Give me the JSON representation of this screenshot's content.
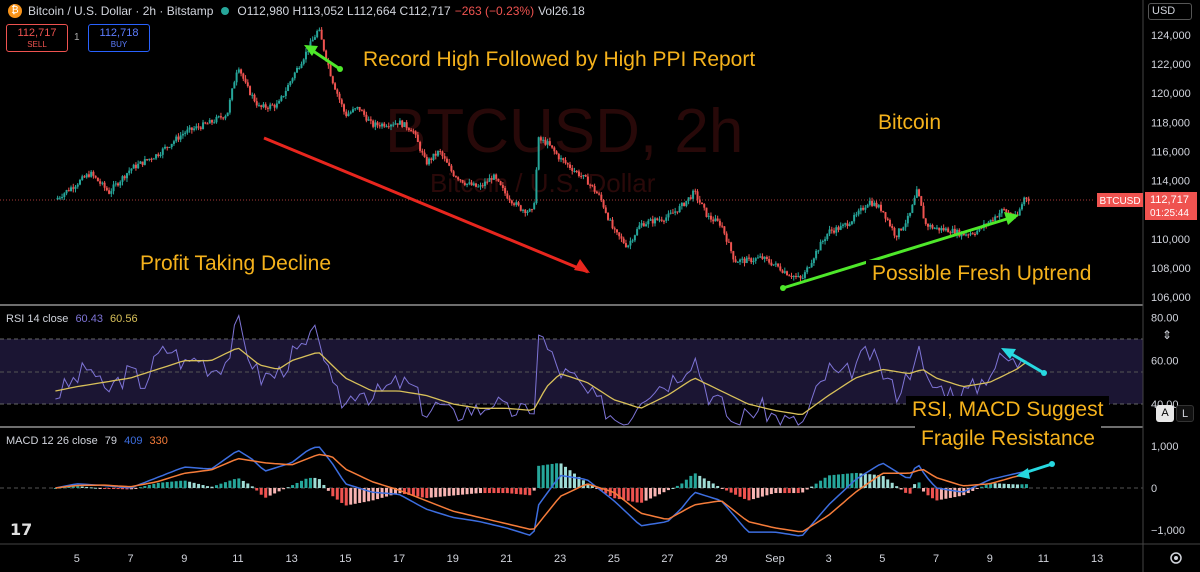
{
  "header": {
    "logo_glyph": "₿",
    "title": "Bitcoin / U.S. Dollar · 2h · Bitstamp",
    "ohlc": "O112,980 H113,052 L112,664 C112,717",
    "change": "−263 (−0.23%)",
    "volume": "Vol26.18"
  },
  "trade": {
    "sell_price": "112,717",
    "sell_label": "SELL",
    "spread": "1",
    "buy_price": "112,718",
    "buy_label": "BUY"
  },
  "currency_button": "USD",
  "scale_buttons": {
    "auto": "A",
    "log": "L"
  },
  "watermark": {
    "symbol": "BTCUSD, 2h",
    "subtitle": "Bitcoin / U.S. Dollar"
  },
  "annotations": {
    "record_high": "Record High Followed by High PPI Report",
    "bitcoin": "Bitcoin",
    "profit_taking": "Profit Taking Decline",
    "uptrend": "Possible Fresh Uptrend",
    "rsi_macd_line1": "RSI, MACD Suggest",
    "rsi_macd_line2": "Fragile Resistance"
  },
  "price_badge": {
    "symbol": "BTCUSD",
    "price": "112,717",
    "countdown": "01:25:44"
  },
  "rsi_label": {
    "text": "RSI 14 close",
    "rsi": "60.43",
    "ma": "60.56"
  },
  "macd_label": {
    "text": "MACD 12 26 close",
    "hist": "79",
    "macd": "409",
    "signal": "330"
  },
  "logo_text": "17",
  "colors": {
    "up": "#26a69a",
    "down": "#ef5350",
    "rsi": "#7e74d6",
    "rsi_ma": "#d8c05a",
    "macd": "#3d6ee0",
    "signal": "#f57c3a",
    "annotation": "#f5b21c",
    "arrow_red": "#e8261e",
    "arrow_green": "#4ee82a",
    "arrow_cyan": "#27d8e0"
  },
  "chart_data": [
    {
      "type": "candlestick",
      "ylim": [
        105500,
        125000
      ],
      "y_ticks": [
        "106,000",
        "108,000",
        "110,000",
        "112,000",
        "114,000",
        "116,000",
        "118,000",
        "120,000",
        "122,000",
        "124,000"
      ],
      "x_ticks": [
        "5",
        "7",
        "9",
        "11",
        "13",
        "15",
        "17",
        "19",
        "21",
        "23",
        "25",
        "27",
        "29",
        "Sep",
        "3",
        "5",
        "7",
        "9",
        "11",
        "13"
      ],
      "last_close": 112717,
      "path": [
        [
          4.2,
          112700
        ],
        [
          5.5,
          114500
        ],
        [
          6.2,
          113200
        ],
        [
          7,
          114800
        ],
        [
          8,
          115800
        ],
        [
          9,
          117300
        ],
        [
          10,
          118000
        ],
        [
          10.6,
          118600
        ],
        [
          11,
          122000
        ],
        [
          11.3,
          120500
        ],
        [
          11.8,
          119000
        ],
        [
          12.5,
          119200
        ],
        [
          13,
          121000
        ],
        [
          13.6,
          123000
        ],
        [
          14,
          124400
        ],
        [
          14.5,
          121000
        ],
        [
          15,
          118500
        ],
        [
          15.5,
          119000
        ],
        [
          16,
          117800
        ],
        [
          17,
          118000
        ],
        [
          17.5,
          117500
        ],
        [
          18,
          115200
        ],
        [
          18.5,
          116000
        ],
        [
          19,
          114500
        ],
        [
          19.5,
          113800
        ],
        [
          20,
          113500
        ],
        [
          20.5,
          114300
        ],
        [
          21,
          113000
        ],
        [
          21.5,
          112100
        ],
        [
          22,
          111800
        ],
        [
          22.2,
          116800
        ],
        [
          22.5,
          116600
        ],
        [
          23,
          115500
        ],
        [
          24,
          114000
        ],
        [
          24.5,
          112800
        ],
        [
          25,
          110500
        ],
        [
          25.5,
          109500
        ],
        [
          26,
          111000
        ],
        [
          27,
          111500
        ],
        [
          27.5,
          112200
        ],
        [
          28,
          113200
        ],
        [
          28.5,
          111500
        ],
        [
          29,
          111000
        ],
        [
          29.5,
          108500
        ],
        [
          30,
          108500
        ],
        [
          30.5,
          108700
        ],
        [
          31,
          108200
        ],
        [
          31.5,
          107600
        ],
        [
          32,
          107200
        ],
        [
          32.5,
          109000
        ],
        [
          33,
          110500
        ],
        [
          33.5,
          110800
        ],
        [
          34,
          111500
        ],
        [
          34.5,
          112600
        ],
        [
          35,
          112000
        ],
        [
          35.5,
          110200
        ],
        [
          36,
          111500
        ],
        [
          36.3,
          113300
        ],
        [
          36.6,
          111000
        ],
        [
          37,
          110700
        ],
        [
          37.5,
          110600
        ],
        [
          38,
          110300
        ],
        [
          38.5,
          110500
        ],
        [
          39,
          111200
        ],
        [
          39.5,
          112000
        ],
        [
          40,
          111400
        ],
        [
          40.3,
          112900
        ],
        [
          40.5,
          112717
        ]
      ]
    },
    {
      "type": "line",
      "name": "RSI 14 close",
      "ylim": [
        20,
        85
      ],
      "y_ticks": [
        "80.00",
        "60.00",
        "40.00"
      ],
      "series": [
        {
          "name": "RSI",
          "values": [
            [
              4.2,
              44
            ],
            [
              5,
              52
            ],
            [
              5.5,
              58
            ],
            [
              6,
              45
            ],
            [
              6.5,
              50
            ],
            [
              7,
              55
            ],
            [
              7.5,
              49
            ],
            [
              8,
              62
            ],
            [
              8.5,
              66
            ],
            [
              9,
              58
            ],
            [
              9.5,
              62
            ],
            [
              10,
              56
            ],
            [
              10.6,
              60
            ],
            [
              11,
              78
            ],
            [
              11.3,
              66
            ],
            [
              11.8,
              52
            ],
            [
              12.5,
              54
            ],
            [
              13,
              62
            ],
            [
              13.5,
              66
            ],
            [
              14,
              74
            ],
            [
              14.5,
              46
            ],
            [
              15,
              40
            ],
            [
              15.5,
              48
            ],
            [
              16,
              43
            ],
            [
              16.5,
              47
            ],
            [
              17,
              50
            ],
            [
              17.5,
              48
            ],
            [
              18,
              36
            ],
            [
              18.5,
              40
            ],
            [
              19,
              34
            ],
            [
              19.5,
              38
            ],
            [
              20,
              37
            ],
            [
              20.5,
              42
            ],
            [
              21,
              36
            ],
            [
              21.5,
              38
            ],
            [
              22,
              32
            ],
            [
              22.2,
              74
            ],
            [
              22.5,
              66
            ],
            [
              23,
              55
            ],
            [
              23.5,
              52
            ],
            [
              24,
              45
            ],
            [
              24.5,
              40
            ],
            [
              25,
              34
            ],
            [
              25.5,
              32
            ],
            [
              26,
              44
            ],
            [
              26.5,
              48
            ],
            [
              27,
              50
            ],
            [
              27.5,
              55
            ],
            [
              28,
              62
            ],
            [
              28.5,
              45
            ],
            [
              29,
              40
            ],
            [
              29.5,
              30
            ],
            [
              30,
              36
            ],
            [
              30.5,
              38
            ],
            [
              31,
              34
            ],
            [
              31.5,
              32
            ],
            [
              32,
              30
            ],
            [
              32.5,
              44
            ],
            [
              33,
              56
            ],
            [
              33.5,
              52
            ],
            [
              34,
              58
            ],
            [
              34.5,
              64
            ],
            [
              35,
              55
            ],
            [
              35.5,
              45
            ],
            [
              36,
              54
            ],
            [
              36.3,
              68
            ],
            [
              36.6,
              50
            ],
            [
              37,
              48
            ],
            [
              37.5,
              46
            ],
            [
              38,
              45
            ],
            [
              38.5,
              48
            ],
            [
              39,
              55
            ],
            [
              39.5,
              62
            ],
            [
              40,
              58
            ],
            [
              40.3,
              66
            ],
            [
              40.5,
              60.43
            ]
          ]
        },
        {
          "name": "RSI MA",
          "values": [
            [
              4.2,
              46
            ],
            [
              5,
              48
            ],
            [
              6,
              50
            ],
            [
              7,
              52
            ],
            [
              8,
              56
            ],
            [
              9,
              60
            ],
            [
              10,
              60
            ],
            [
              11,
              66
            ],
            [
              11.8,
              58
            ],
            [
              12.5,
              56
            ],
            [
              13,
              60
            ],
            [
              14,
              64
            ],
            [
              14.5,
              58
            ],
            [
              15,
              52
            ],
            [
              16,
              46
            ],
            [
              17,
              46
            ],
            [
              18,
              44
            ],
            [
              19,
              40
            ],
            [
              20,
              38
            ],
            [
              21,
              38
            ],
            [
              22,
              37
            ],
            [
              22.5,
              48
            ],
            [
              23,
              54
            ],
            [
              24,
              50
            ],
            [
              25,
              42
            ],
            [
              26,
              38
            ],
            [
              27,
              44
            ],
            [
              28,
              52
            ],
            [
              29,
              46
            ],
            [
              30,
              40
            ],
            [
              31,
              37
            ],
            [
              32,
              35
            ],
            [
              33,
              44
            ],
            [
              34,
              52
            ],
            [
              35,
              56
            ],
            [
              36,
              54
            ],
            [
              36.5,
              56
            ],
            [
              37,
              52
            ],
            [
              38,
              48
            ],
            [
              39,
              50
            ],
            [
              40,
              56
            ],
            [
              40.5,
              60.56
            ]
          ]
        }
      ]
    },
    {
      "type": "bar",
      "name": "MACD 12 26 close",
      "ylim": [
        -1400,
        1500
      ],
      "y_ticks": [
        "1,000",
        "0",
        "−1,000"
      ],
      "series": [
        {
          "name": "MACD",
          "values": [
            [
              4.2,
              0
            ],
            [
              5,
              100
            ],
            [
              6,
              60
            ],
            [
              7,
              0
            ],
            [
              8,
              250
            ],
            [
              9,
              500
            ],
            [
              10,
              450
            ],
            [
              11,
              900
            ],
            [
              11.5,
              700
            ],
            [
              12,
              400
            ],
            [
              13,
              600
            ],
            [
              13.6,
              900
            ],
            [
              14,
              1000
            ],
            [
              14.5,
              600
            ],
            [
              15,
              100
            ],
            [
              16,
              -100
            ],
            [
              17,
              -150
            ],
            [
              18,
              -500
            ],
            [
              19,
              -700
            ],
            [
              20,
              -800
            ],
            [
              21,
              -950
            ],
            [
              22,
              -1150
            ],
            [
              22.2,
              -400
            ],
            [
              23,
              300
            ],
            [
              24,
              200
            ],
            [
              25,
              -300
            ],
            [
              26,
              -900
            ],
            [
              27,
              -800
            ],
            [
              27.5,
              -500
            ],
            [
              28,
              -100
            ],
            [
              29,
              -300
            ],
            [
              30,
              -1050
            ],
            [
              31,
              -1050
            ],
            [
              32,
              -1150
            ],
            [
              33,
              -400
            ],
            [
              34,
              200
            ],
            [
              35,
              600
            ],
            [
              35.5,
              400
            ],
            [
              36,
              200
            ],
            [
              36.3,
              600
            ],
            [
              36.6,
              300
            ],
            [
              37,
              0
            ],
            [
              38,
              -100
            ],
            [
              39,
              200
            ],
            [
              40,
              350
            ],
            [
              40.5,
              409
            ]
          ]
        },
        {
          "name": "Signal",
          "values": [
            [
              4.2,
              0
            ],
            [
              5,
              60
            ],
            [
              6,
              70
            ],
            [
              7,
              30
            ],
            [
              8,
              150
            ],
            [
              9,
              350
            ],
            [
              10,
              430
            ],
            [
              11,
              700
            ],
            [
              12,
              600
            ],
            [
              13,
              550
            ],
            [
              14,
              800
            ],
            [
              14.5,
              750
            ],
            [
              15,
              450
            ],
            [
              16,
              150
            ],
            [
              17,
              -50
            ],
            [
              18,
              -300
            ],
            [
              19,
              -550
            ],
            [
              20,
              -700
            ],
            [
              21,
              -850
            ],
            [
              22,
              -1000
            ],
            [
              23,
              -200
            ],
            [
              24,
              100
            ],
            [
              25,
              -100
            ],
            [
              26,
              -600
            ],
            [
              27,
              -750
            ],
            [
              28,
              -400
            ],
            [
              29,
              -300
            ],
            [
              30,
              -800
            ],
            [
              31,
              -950
            ],
            [
              32,
              -1050
            ],
            [
              33,
              -650
            ],
            [
              34,
              -100
            ],
            [
              35,
              350
            ],
            [
              36,
              350
            ],
            [
              36.5,
              450
            ],
            [
              37,
              250
            ],
            [
              38,
              50
            ],
            [
              39,
              100
            ],
            [
              40,
              280
            ],
            [
              40.5,
              330
            ]
          ]
        }
      ]
    }
  ]
}
